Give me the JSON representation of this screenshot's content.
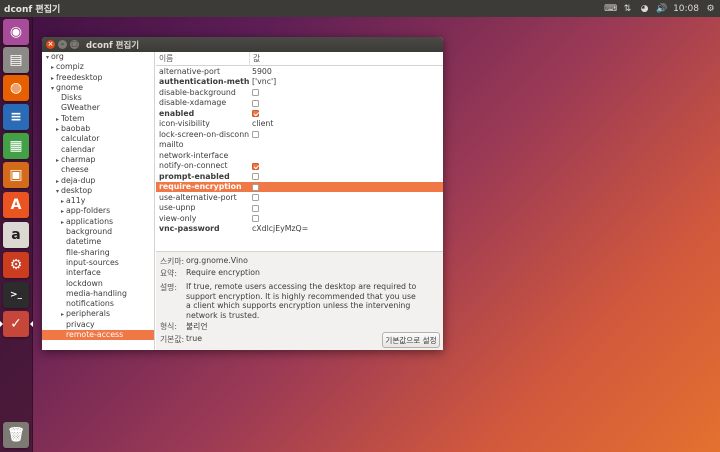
{
  "top_panel": {
    "title": "dconf 편집기",
    "time": "10:08"
  },
  "launcher": {
    "items": [
      {
        "name": "dash-home",
        "color": "#a74c98",
        "glyph": "◉"
      },
      {
        "name": "files",
        "color": "#8c8a86",
        "glyph": "▤"
      },
      {
        "name": "firefox",
        "color": "#e66000",
        "glyph": "◍"
      },
      {
        "name": "libreoffice-writer",
        "color": "#2a6bb5",
        "glyph": "≡"
      },
      {
        "name": "libreoffice-calc",
        "color": "#43a047",
        "glyph": "▦"
      },
      {
        "name": "libreoffice-impress",
        "color": "#d46b1a",
        "glyph": "▣"
      },
      {
        "name": "software-center",
        "color": "#e95420",
        "glyph": "A"
      },
      {
        "name": "amazon",
        "color": "#dcd8d2",
        "glyph": "a"
      },
      {
        "name": "system-settings",
        "color": "#cc3c1e",
        "glyph": "⚙"
      },
      {
        "name": "terminal",
        "color": "#2c2c2c",
        "glyph": ">_"
      },
      {
        "name": "dconf-editor",
        "color": "#c7463a",
        "glyph": "✓"
      },
      {
        "name": "trash",
        "color": "#7d7a73",
        "glyph": "🗑"
      }
    ]
  },
  "window": {
    "title": "dconf 편집기",
    "tree": [
      {
        "label": "org",
        "indent": 0,
        "twisty": "▾"
      },
      {
        "label": "compiz",
        "indent": 1,
        "twisty": "▸"
      },
      {
        "label": "freedesktop",
        "indent": 1,
        "twisty": "▸"
      },
      {
        "label": "gnome",
        "indent": 1,
        "twisty": "▾"
      },
      {
        "label": "Disks",
        "indent": 2,
        "twisty": ""
      },
      {
        "label": "GWeather",
        "indent": 2,
        "twisty": ""
      },
      {
        "label": "Totem",
        "indent": 2,
        "twisty": "▸"
      },
      {
        "label": "baobab",
        "indent": 2,
        "twisty": "▸"
      },
      {
        "label": "calculator",
        "indent": 2,
        "twisty": ""
      },
      {
        "label": "calendar",
        "indent": 2,
        "twisty": ""
      },
      {
        "label": "charmap",
        "indent": 2,
        "twisty": "▸"
      },
      {
        "label": "cheese",
        "indent": 2,
        "twisty": ""
      },
      {
        "label": "deja-dup",
        "indent": 2,
        "twisty": "▸"
      },
      {
        "label": "desktop",
        "indent": 2,
        "twisty": "▾"
      },
      {
        "label": "a11y",
        "indent": 3,
        "twisty": "▸"
      },
      {
        "label": "app-folders",
        "indent": 3,
        "twisty": "▸"
      },
      {
        "label": "applications",
        "indent": 3,
        "twisty": "▸"
      },
      {
        "label": "background",
        "indent": 3,
        "twisty": ""
      },
      {
        "label": "datetime",
        "indent": 3,
        "twisty": ""
      },
      {
        "label": "file-sharing",
        "indent": 3,
        "twisty": ""
      },
      {
        "label": "input-sources",
        "indent": 3,
        "twisty": ""
      },
      {
        "label": "interface",
        "indent": 3,
        "twisty": ""
      },
      {
        "label": "lockdown",
        "indent": 3,
        "twisty": ""
      },
      {
        "label": "media-handling",
        "indent": 3,
        "twisty": ""
      },
      {
        "label": "notifications",
        "indent": 3,
        "twisty": ""
      },
      {
        "label": "peripherals",
        "indent": 3,
        "twisty": "▸"
      },
      {
        "label": "privacy",
        "indent": 3,
        "twisty": ""
      },
      {
        "label": "remote-access",
        "indent": 3,
        "twisty": "",
        "selected": true
      }
    ],
    "columns": {
      "name": "이름",
      "value": "값"
    },
    "keys": [
      {
        "key": "alternative-port",
        "value": "5900",
        "type": "text"
      },
      {
        "key": "authentication-methods",
        "value": "['vnc']",
        "type": "text",
        "bold": true
      },
      {
        "key": "disable-background",
        "type": "check",
        "checked": false
      },
      {
        "key": "disable-xdamage",
        "type": "check",
        "checked": false
      },
      {
        "key": "enabled",
        "type": "check",
        "checked": true,
        "bold": true
      },
      {
        "key": "icon-visibility",
        "value": "client",
        "type": "text"
      },
      {
        "key": "lock-screen-on-disconnect",
        "type": "check",
        "checked": false
      },
      {
        "key": "mailto",
        "value": "",
        "type": "text"
      },
      {
        "key": "network-interface",
        "value": "",
        "type": "text"
      },
      {
        "key": "notify-on-connect",
        "type": "check",
        "checked": true
      },
      {
        "key": "prompt-enabled",
        "type": "check",
        "checked": false,
        "bold": true
      },
      {
        "key": "require-encryption",
        "type": "check",
        "checked": false,
        "bold": true,
        "selected": true
      },
      {
        "key": "use-alternative-port",
        "type": "check",
        "checked": false
      },
      {
        "key": "use-upnp",
        "type": "check",
        "checked": false
      },
      {
        "key": "view-only",
        "type": "check",
        "checked": false
      },
      {
        "key": "vnc-password",
        "value": "cXdlcjEyMzQ=",
        "type": "text",
        "bold": true
      }
    ],
    "info": {
      "schema_label": "스키마:",
      "schema_value": "org.gnome.Vino",
      "summary_label": "요약:",
      "summary_value": "Require encryption",
      "description_label": "설명:",
      "description_value": "If true, remote users accessing the desktop are required to support encryption. It is highly recommended that you use a client which supports encryption unless the intervening network is trusted.",
      "type_label": "형식:",
      "type_value": "불리언",
      "default_label": "기본값:",
      "default_value": "true",
      "reset_button": "기본값으로 설정"
    }
  }
}
